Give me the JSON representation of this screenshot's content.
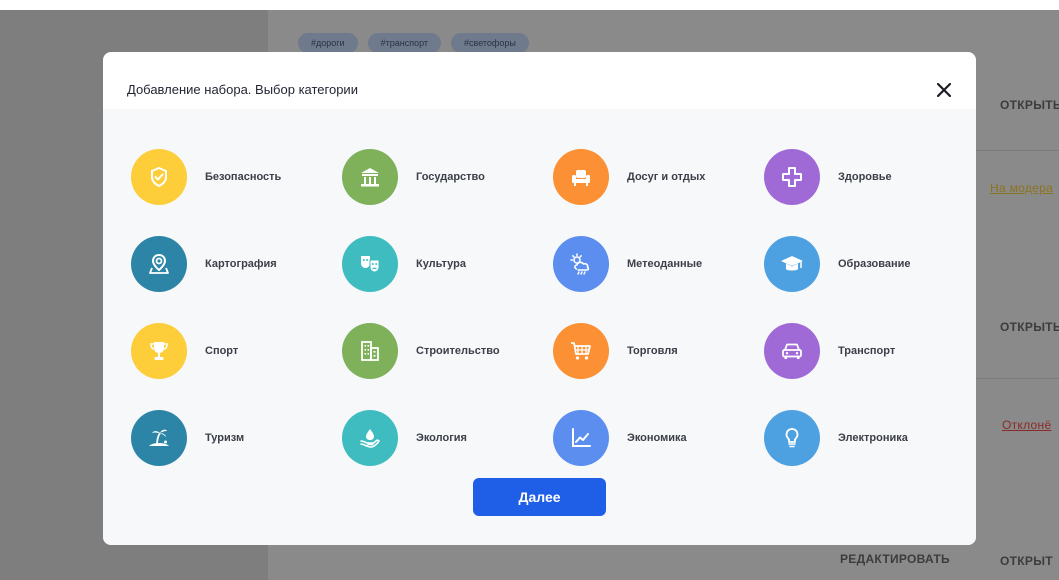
{
  "background": {
    "tags": [
      "#дороги",
      "#транспорт",
      "#светофоры"
    ],
    "right_actions": [
      {
        "text": "ОТКРЫТЬ",
        "kind": "open"
      },
      {
        "text": "На модера",
        "kind": "moderation"
      },
      {
        "text": "ОТКРЫТЬ",
        "kind": "open"
      },
      {
        "text": "Отклонё",
        "kind": "rejected"
      },
      {
        "text": "ОТКРЫТ",
        "kind": "open"
      }
    ],
    "edit_label": "РЕДАКТИРОВАТЬ"
  },
  "modal": {
    "title": "Добавление набора. Выбор категории",
    "close_icon": "close-icon",
    "next_label": "Далее",
    "categories": [
      {
        "label": "Безопасность",
        "icon": "shield-icon",
        "color": "#FDCD3A"
      },
      {
        "label": "Государство",
        "icon": "building-icon",
        "color": "#7FB05A"
      },
      {
        "label": "Досуг и отдых",
        "icon": "armchair-icon",
        "color": "#FB9034"
      },
      {
        "label": "Здоровье",
        "icon": "medical-cross-icon",
        "color": "#A06AD6"
      },
      {
        "label": "Картография",
        "icon": "map-pin-icon",
        "color": "#2C85A6"
      },
      {
        "label": "Культура",
        "icon": "theater-masks-icon",
        "color": "#3EBCC0"
      },
      {
        "label": "Метеоданные",
        "icon": "weather-icon",
        "color": "#5C8EF0"
      },
      {
        "label": "Образование",
        "icon": "graduation-cap-icon",
        "color": "#4EA1E0"
      },
      {
        "label": "Спорт",
        "icon": "trophy-icon",
        "color": "#FDCD3A"
      },
      {
        "label": "Строительство",
        "icon": "buildings-icon",
        "color": "#7FB05A"
      },
      {
        "label": "Торговля",
        "icon": "cart-icon",
        "color": "#FB9034"
      },
      {
        "label": "Транспорт",
        "icon": "car-icon",
        "color": "#A06AD6"
      },
      {
        "label": "Туризм",
        "icon": "island-icon",
        "color": "#2C85A6"
      },
      {
        "label": "Экология",
        "icon": "eco-hand-icon",
        "color": "#3EBCC0"
      },
      {
        "label": "Экономика",
        "icon": "chart-icon",
        "color": "#5C8EF0"
      },
      {
        "label": "Электроника",
        "icon": "lightbulb-icon",
        "color": "#4EA1E0"
      }
    ]
  }
}
